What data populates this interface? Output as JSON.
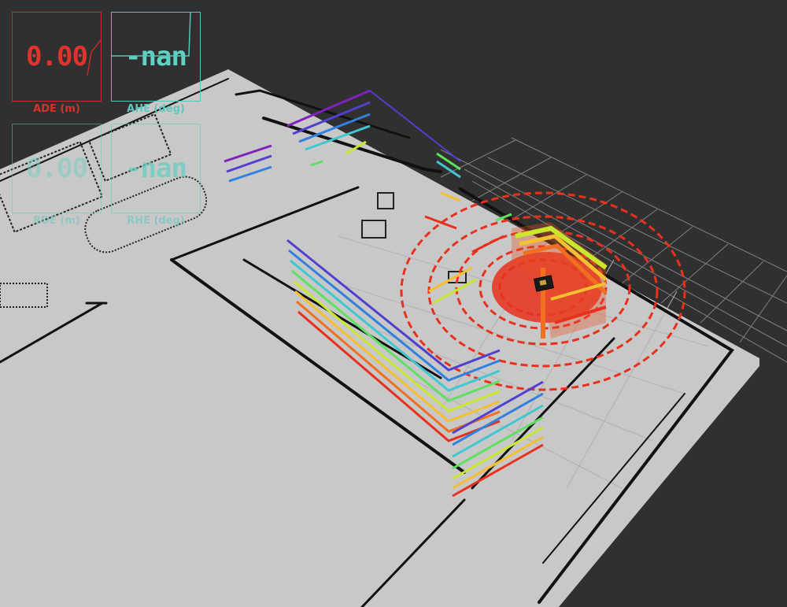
{
  "overlays": {
    "ade": {
      "value": "0.00",
      "label": "ADE (m)",
      "color": "#e0332d"
    },
    "ahe": {
      "value": "-nan",
      "label": "AHE (deg)",
      "color": "#5fd2c3"
    },
    "rde": {
      "value": "0.00",
      "label": "RDE (m)",
      "color": "#78cdc3"
    },
    "rhe": {
      "value": "-nan",
      "label": "RHE (deg)",
      "color": "#64cdc3"
    }
  },
  "scene": {
    "background": "#303030",
    "map_floor": "#c8c8c8",
    "grid_color": "#8a8a8a",
    "scan_palette": [
      "#e8301c",
      "#f07020",
      "#f5c030",
      "#c8e830",
      "#60e060",
      "#40c8d0",
      "#3080e0",
      "#5040d0",
      "#8020c0"
    ]
  }
}
